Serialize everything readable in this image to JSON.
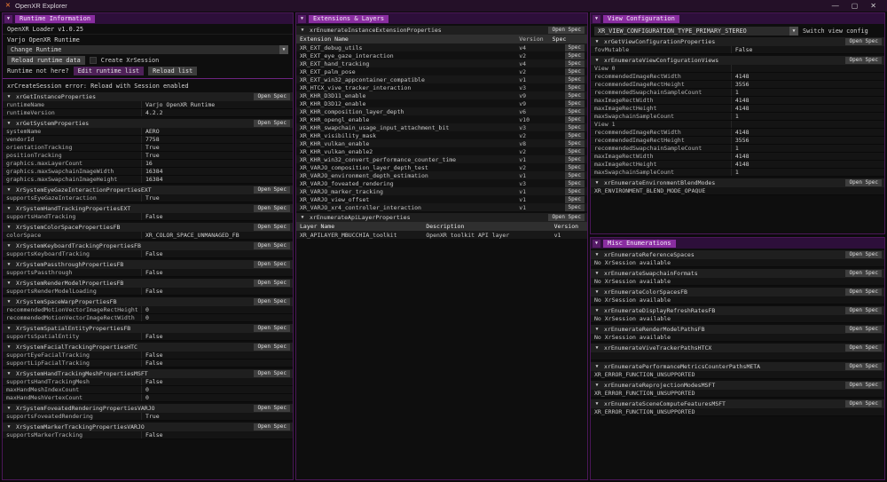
{
  "titlebar": {
    "app_title": "OpenXR Explorer",
    "app_icon_glyph": "✕",
    "minimize": "—",
    "maximize": "▢",
    "close": "✕"
  },
  "labels": {
    "open_spec": "Open Spec",
    "spec": "Spec",
    "collapse_icon": "▼",
    "dropdown_arrow": "▼"
  },
  "colors": {
    "accent_purple": "#892da0",
    "panel_border": "#4b1758",
    "titlebar_bg": "#241028",
    "separator_purple": "#6c2480"
  },
  "runtime_panel": {
    "title": "Runtime Information",
    "loader_version": "OpenXR Loader v1.0.25",
    "runtime_name": "Varjo OpenXR Runtime",
    "runtime_dropdown_value": "Change Runtime",
    "reload_data_button": "Reload runtime data",
    "create_session_label": "Create XrSession",
    "not_here_label": "Runtime not here?",
    "edit_runtime_button": "Edit runtime list",
    "reload_list_button": "Reload list",
    "error_text": "xrCreateSession error: Reload with Session enabled",
    "sections": [
      {
        "title": "xrGetInstanceProperties",
        "rows": [
          [
            "runtimeName",
            "Varjo OpenXR Runtime"
          ],
          [
            "runtimeVersion",
            "4.2.2"
          ]
        ]
      },
      {
        "title": "xrGetSystemProperties",
        "rows": [
          [
            "systemName",
            "AERO"
          ],
          [
            "vendorId",
            "7758"
          ],
          [
            "orientationTracking",
            "True"
          ],
          [
            "positionTracking",
            "True"
          ],
          [
            "graphics.maxLayerCount",
            "16"
          ],
          [
            "graphics.maxSwapchainImageWidth",
            "16384"
          ],
          [
            "graphics.maxSwapchainImageHeight",
            "16384"
          ]
        ]
      },
      {
        "title": "XrSystemEyeGazeInteractionPropertiesEXT",
        "rows": [
          [
            "supportsEyeGazeInteraction",
            "True"
          ]
        ]
      },
      {
        "title": "XrSystemHandTrackingPropertiesEXT",
        "rows": [
          [
            "supportsHandTracking",
            "False"
          ]
        ]
      },
      {
        "title": "XrSystemColorSpacePropertiesFB",
        "rows": [
          [
            "colorSpace",
            "XR_COLOR_SPACE_UNMANAGED_FB"
          ]
        ]
      },
      {
        "title": "XrSystemKeyboardTrackingPropertiesFB",
        "rows": [
          [
            "supportsKeyboardTracking",
            "False"
          ]
        ]
      },
      {
        "title": "XrSystemPassthroughPropertiesFB",
        "rows": [
          [
            "supportsPassthrough",
            "False"
          ]
        ]
      },
      {
        "title": "XrSystemRenderModelPropertiesFB",
        "rows": [
          [
            "supportsRenderModelLoading",
            "False"
          ]
        ]
      },
      {
        "title": "XrSystemSpaceWarpPropertiesFB",
        "rows": [
          [
            "recommendedMotionVectorImageRectHeight",
            "0"
          ],
          [
            "recommendedMotionVectorImageRectWidth",
            "0"
          ]
        ]
      },
      {
        "title": "XrSystemSpatialEntityPropertiesFB",
        "rows": [
          [
            "supportsSpatialEntity",
            "False"
          ]
        ]
      },
      {
        "title": "XrSystemFacialTrackingPropertiesHTC",
        "rows": [
          [
            "supportEyeFacialTracking",
            "False"
          ],
          [
            "supportLipFacialTracking",
            "False"
          ]
        ]
      },
      {
        "title": "XrSystemHandTrackingMeshPropertiesMSFT",
        "rows": [
          [
            "supportsHandTrackingMesh",
            "False"
          ],
          [
            "maxHandMeshIndexCount",
            "0"
          ],
          [
            "maxHandMeshVertexCount",
            "0"
          ]
        ]
      },
      {
        "title": "XrSystemFoveatedRenderingPropertiesVARJO",
        "rows": [
          [
            "supportsFoveatedRendering",
            "True"
          ]
        ]
      },
      {
        "title": "XrSystemMarkerTrackingPropertiesVARJO",
        "rows": [
          [
            "supportsMarkerTracking",
            "False"
          ]
        ]
      }
    ]
  },
  "extensions_panel": {
    "title": "Extensions & Layers",
    "extensions_section_title": "xrEnumerateInstanceExtensionProperties",
    "extensions_columns": [
      "Extension Name",
      "Version",
      "Spec"
    ],
    "extensions": [
      [
        "XR_EXT_debug_utils",
        "v4"
      ],
      [
        "XR_EXT_eye_gaze_interaction",
        "v2"
      ],
      [
        "XR_EXT_hand_tracking",
        "v4"
      ],
      [
        "XR_EXT_palm_pose",
        "v2"
      ],
      [
        "XR_EXT_win32_appcontainer_compatible",
        "v1"
      ],
      [
        "XR_HTCX_vive_tracker_interaction",
        "v3"
      ],
      [
        "XR_KHR_D3D11_enable",
        "v9"
      ],
      [
        "XR_KHR_D3D12_enable",
        "v9"
      ],
      [
        "XR_KHR_composition_layer_depth",
        "v6"
      ],
      [
        "XR_KHR_opengl_enable",
        "v10"
      ],
      [
        "XR_KHR_swapchain_usage_input_attachment_bit",
        "v3"
      ],
      [
        "XR_KHR_visibility_mask",
        "v2"
      ],
      [
        "XR_KHR_vulkan_enable",
        "v8"
      ],
      [
        "XR_KHR_vulkan_enable2",
        "v2"
      ],
      [
        "XR_KHR_win32_convert_performance_counter_time",
        "v1"
      ],
      [
        "XR_VARJO_composition_layer_depth_test",
        "v2"
      ],
      [
        "XR_VARJO_environment_depth_estimation",
        "v1"
      ],
      [
        "XR_VARJO_foveated_rendering",
        "v3"
      ],
      [
        "XR_VARJO_marker_tracking",
        "v1"
      ],
      [
        "XR_VARJO_view_offset",
        "v1"
      ],
      [
        "XR_VARJO_xr4_controller_interaction",
        "v1"
      ]
    ],
    "layers_section_title": "xrEnumerateApiLayerProperties",
    "layers_columns": [
      "Layer Name",
      "Description",
      "Version"
    ],
    "layers": [
      [
        "XR_APILAYER_MBUCCHIA_toolkit",
        "OpenXR toolkit API layer",
        "v1"
      ]
    ]
  },
  "view_panel": {
    "title": "View Configuration",
    "dropdown_value": "XR_VIEW_CONFIGURATION_TYPE_PRIMARY_STEREO",
    "dropdown_label": "Switch view config",
    "sections": [
      {
        "title": "xrGetViewConfigurationProperties",
        "rows": [
          [
            "fovMutable",
            "False"
          ]
        ]
      },
      {
        "title": "xrEnumerateViewConfigurationViews",
        "rows": [
          [
            "View 0",
            ""
          ],
          [
            "recommendedImageRectWidth",
            "4148"
          ],
          [
            "recommendedImageRectHeight",
            "3556"
          ],
          [
            "recommendedSwapchainSampleCount",
            "1"
          ],
          [
            "maxImageRectWidth",
            "4148"
          ],
          [
            "maxImageRectHeight",
            "4148"
          ],
          [
            "maxSwapchainSampleCount",
            "1"
          ],
          [
            "View 1",
            ""
          ],
          [
            "recommendedImageRectWidth",
            "4148"
          ],
          [
            "recommendedImageRectHeight",
            "3556"
          ],
          [
            "recommendedSwapchainSampleCount",
            "1"
          ],
          [
            "maxImageRectWidth",
            "4148"
          ],
          [
            "maxImageRectHeight",
            "4148"
          ],
          [
            "maxSwapchainSampleCount",
            "1"
          ]
        ]
      },
      {
        "title": "xrEnumerateEnvironmentBlendModes",
        "rows": [
          [
            "XR_ENVIRONMENT_BLEND_MODE_OPAQUE"
          ]
        ]
      }
    ]
  },
  "misc_panel": {
    "title": "Misc Enumerations",
    "sections": [
      {
        "title": "xrEnumerateReferenceSpaces",
        "rows": [
          [
            "No XrSession available"
          ]
        ]
      },
      {
        "title": "xrEnumerateSwapchainFormats",
        "rows": [
          [
            "No XrSession available"
          ]
        ]
      },
      {
        "title": "xrEnumerateColorSpacesFB",
        "rows": [
          [
            "No XrSession available"
          ]
        ]
      },
      {
        "title": "xrEnumerateDisplayRefreshRatesFB",
        "rows": [
          [
            "No XrSession available"
          ]
        ]
      },
      {
        "title": "xrEnumerateRenderModelPathsFB",
        "rows": [
          [
            "No XrSession available"
          ]
        ]
      },
      {
        "title": "xrEnumerateViveTrackerPathsHTCX",
        "rows": [
          [
            ""
          ]
        ]
      },
      {
        "title": "xrEnumeratePerformanceMetricsCounterPathsMETA",
        "rows": [
          [
            "XR_ERROR_FUNCTION_UNSUPPORTED"
          ]
        ]
      },
      {
        "title": "xrEnumerateReprojectionModesMSFT",
        "rows": [
          [
            "XR_ERROR_FUNCTION_UNSUPPORTED"
          ]
        ]
      },
      {
        "title": "xrEnumerateSceneComputeFeaturesMSFT",
        "rows": [
          [
            "XR_ERROR_FUNCTION_UNSUPPORTED"
          ]
        ]
      }
    ]
  }
}
